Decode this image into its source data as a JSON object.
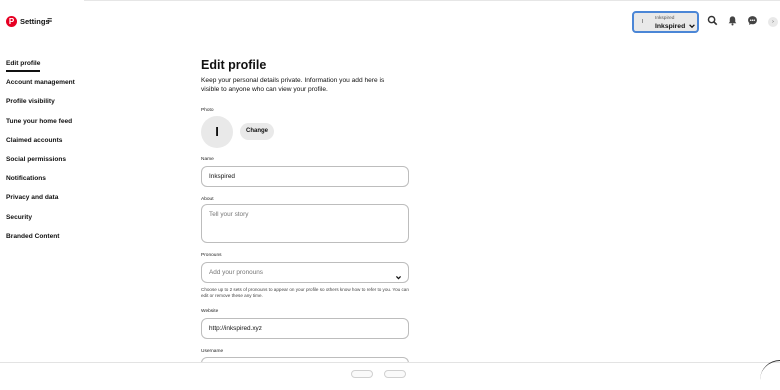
{
  "header": {
    "logo_letter": "P",
    "app_title": "Settings",
    "menu_glyph": "≡",
    "account": {
      "avatar_letter": "I",
      "label_small": "Inkspired",
      "name": "Inkspired"
    },
    "icons": [
      "search-icon",
      "notifications-bell-icon",
      "messages-icon",
      "more-icon"
    ]
  },
  "sidebar": {
    "items": [
      {
        "label": "Edit profile",
        "active": true
      },
      {
        "label": "Account management"
      },
      {
        "label": "Profile visibility"
      },
      {
        "label": "Tune your home feed"
      },
      {
        "label": "Claimed accounts"
      },
      {
        "label": "Social permissions"
      },
      {
        "label": "Notifications"
      },
      {
        "label": "Privacy and data"
      },
      {
        "label": "Security"
      },
      {
        "label": "Branded Content"
      }
    ]
  },
  "main": {
    "title": "Edit profile",
    "description": "Keep your personal details private. Information you add here is visible to anyone who can view your profile.",
    "photo": {
      "label": "Photo",
      "avatar_letter": "I",
      "change_label": "Change"
    },
    "name": {
      "label": "Name",
      "value": "Inkspired"
    },
    "about": {
      "label": "About",
      "placeholder": "Tell your story"
    },
    "pronouns": {
      "label": "Pronouns",
      "placeholder": "Add your pronouns",
      "helper": "Choose up to 2 sets of pronouns to appear on your profile so others know how to refer to you. You can edit or remove these any time."
    },
    "website": {
      "label": "Website",
      "value": "http://inkspired.xyz"
    },
    "username": {
      "label": "Username"
    }
  },
  "colors": {
    "brand": "#e60023",
    "focus_ring": "#4b86d6",
    "chip_bg": "#e9e9e9"
  }
}
